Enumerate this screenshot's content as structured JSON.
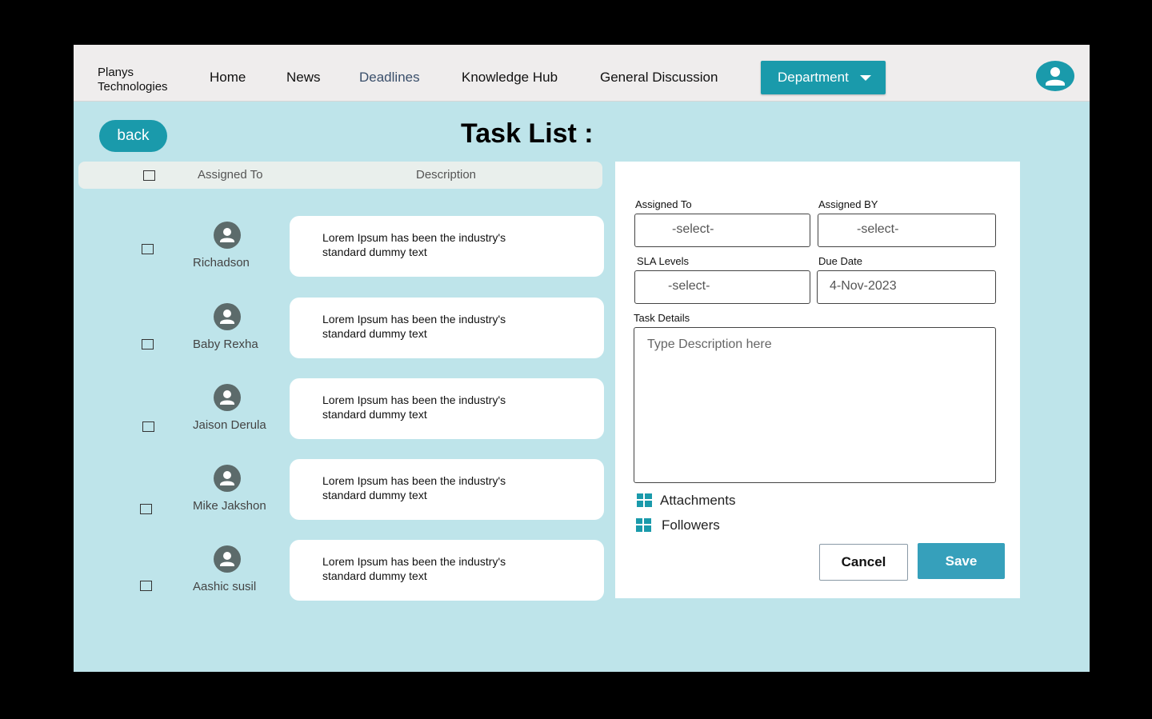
{
  "nav": {
    "brand_line1": "Planys",
    "brand_line2": "Technologies",
    "links": [
      {
        "label": "Home"
      },
      {
        "label": "News"
      },
      {
        "label": "Deadlines"
      },
      {
        "label": "Knowledge Hub"
      },
      {
        "label": "General Discussion"
      }
    ],
    "department_label": "Department"
  },
  "page": {
    "back_label": "back",
    "title": "Task List :"
  },
  "list": {
    "header_assigned": "Assigned To",
    "header_description": "Description",
    "rows": [
      {
        "name": "Richadson",
        "description": "Lorem Ipsum has been the industry's standard dummy text"
      },
      {
        "name": "Baby Rexha",
        "description": "Lorem Ipsum has been the industry's standard dummy text"
      },
      {
        "name": "Jaison Derula",
        "description": "Lorem Ipsum has been the industry's standard dummy text"
      },
      {
        "name": "Mike Jakshon",
        "description": "Lorem Ipsum has been the industry's standard dummy text"
      },
      {
        "name": "Aashic susil",
        "description": "Lorem Ipsum has been the industry's standard dummy text"
      }
    ]
  },
  "form": {
    "assigned_to_label": "Assigned To",
    "assigned_to_value": "-select-",
    "assigned_by_label": "Assigned BY",
    "assigned_by_value": "-select-",
    "sla_label": "SLA Levels",
    "sla_value": "-select-",
    "due_label": "Due Date",
    "due_value": "4-Nov-2023",
    "details_label": "Task Details",
    "details_placeholder": "Type  Description here",
    "attachments_label": "Attachments",
    "followers_label": "Followers",
    "cancel_label": "Cancel",
    "save_label": "Save"
  },
  "colors": {
    "accent": "#1a9aab",
    "background": "#bee4ea",
    "save": "#36a0bb"
  }
}
